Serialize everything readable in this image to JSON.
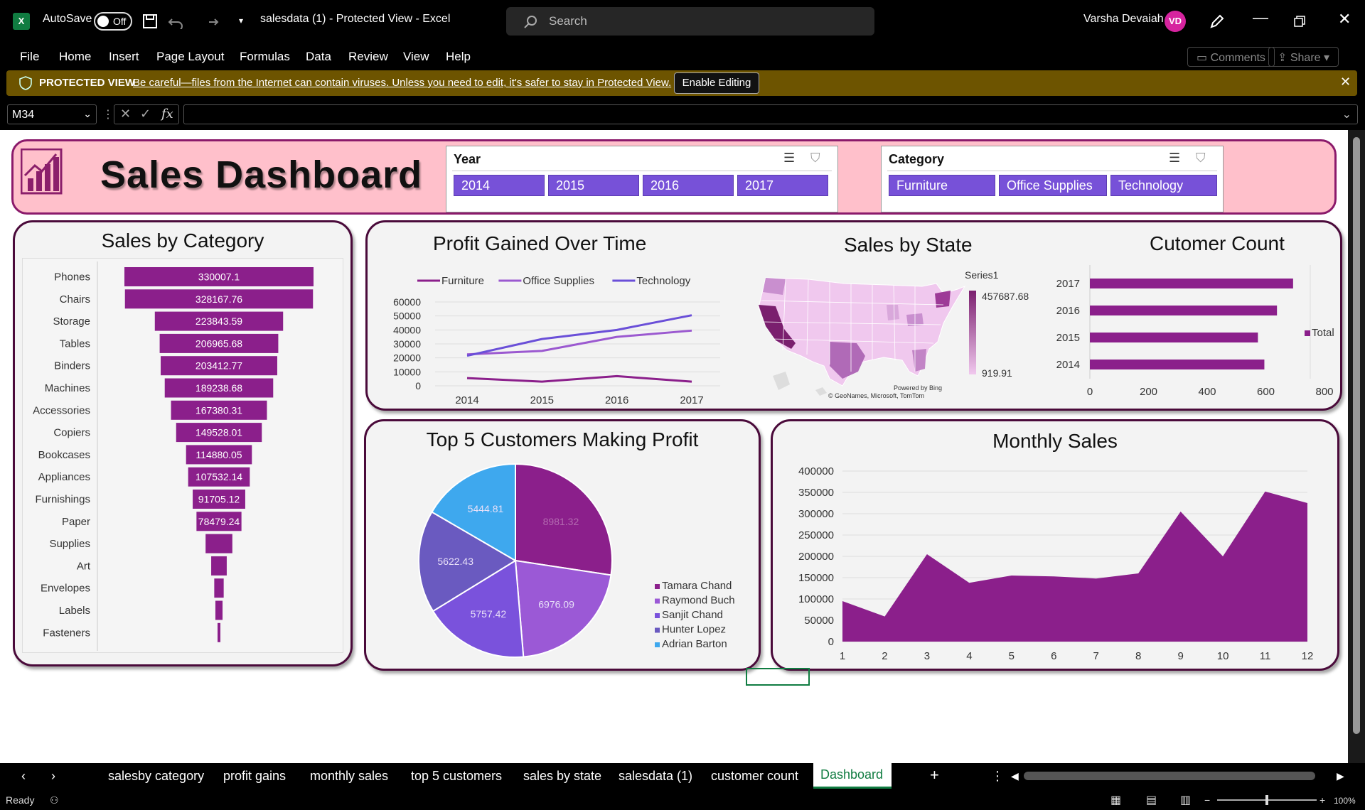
{
  "titlebar": {
    "autosave_label": "AutoSave",
    "autosave_state": "Off",
    "doc_title": "salesdata (1)  -  Protected View  -  Excel",
    "search_placeholder": "Search",
    "user_name": "Varsha Devaiah",
    "user_initials": "VD"
  },
  "menu": [
    "File",
    "Home",
    "Insert",
    "Page Layout",
    "Formulas",
    "Data",
    "Review",
    "View",
    "Help"
  ],
  "ribbon_right": {
    "comments": "Comments",
    "share": "Share"
  },
  "protected_view": {
    "label": "PROTECTED VIEW",
    "message": "Be careful—files from the Internet can contain viruses. Unless you need to edit, it's safer to stay in Protected View.",
    "button": "Enable Editing"
  },
  "formula_bar": {
    "name_box": "M34",
    "fx": "fx"
  },
  "dashboard": {
    "title": "Sales Dashboard",
    "year_slicer": {
      "title": "Year",
      "items": [
        "2014",
        "2015",
        "2016",
        "2017"
      ]
    },
    "category_slicer": {
      "title": "Category",
      "items": [
        "Furniture",
        "Office Supplies",
        "Technology"
      ]
    }
  },
  "colors": {
    "primary": "#8b1f8b",
    "accent": "#7751d8",
    "header_bg": "#ffc0cb",
    "panel_border": "#4a0a3a"
  },
  "chart_data": [
    {
      "id": "sales-by-category",
      "type": "bar",
      "title": "Sales by Category",
      "categories": [
        "Phones",
        "Chairs",
        "Storage",
        "Tables",
        "Binders",
        "Machines",
        "Accessories",
        "Copiers",
        "Bookcases",
        "Appliances",
        "Furnishings",
        "Paper",
        "Supplies",
        "Art",
        "Envelopes",
        "Labels",
        "Fasteners"
      ],
      "values": [
        330007.1,
        328167.76,
        223843.59,
        206965.68,
        203412.77,
        189238.68,
        167380.31,
        149528.01,
        114880.05,
        107532.14,
        91705.12,
        78479.24,
        46673.54,
        27118.79,
        16476.4,
        12486.31,
        3024.28
      ],
      "value_labels": [
        "330007.1",
        "328167.76",
        "223843.59",
        "206965.68",
        "203412.77",
        "189238.68",
        "167380.31",
        "149528.01",
        "114880.05",
        "107532.14",
        "91705.12",
        "78479.24",
        "",
        "",
        "",
        "",
        ""
      ]
    },
    {
      "id": "profit-over-time",
      "type": "line",
      "title": "Profit Gained Over Time",
      "x": [
        "2014",
        "2015",
        "2016",
        "2017"
      ],
      "ylim": [
        0,
        60000
      ],
      "yticks": [
        0,
        10000,
        20000,
        30000,
        40000,
        50000,
        60000
      ],
      "series": [
        {
          "name": "Furniture",
          "color": "#8b1f8b",
          "values": [
            5500,
            3000,
            6900,
            3000
          ]
        },
        {
          "name": "Office Supplies",
          "color": "#9b59d0",
          "values": [
            22500,
            25000,
            35000,
            39500
          ]
        },
        {
          "name": "Technology",
          "color": "#6a4fd8",
          "values": [
            21500,
            33500,
            40000,
            50500
          ]
        }
      ]
    },
    {
      "id": "sales-by-state",
      "type": "heatmap",
      "title": "Sales by State",
      "legend_title": "Series1",
      "max": 457687.68,
      "min": 919.91,
      "max_label": "457687.68",
      "min_label": "919.91",
      "credit1": "Powered by Bing",
      "credit2": "© GeoNames, Microsoft, TomTom"
    },
    {
      "id": "customer-count",
      "type": "bar",
      "title": "Cutomer Count",
      "categories": [
        "2017",
        "2016",
        "2015",
        "2014"
      ],
      "values": [
        693,
        638,
        573,
        595
      ],
      "xlim": [
        0,
        800
      ],
      "xticks": [
        0,
        200,
        400,
        600,
        800
      ],
      "legend": "Total"
    },
    {
      "id": "top5-customers",
      "type": "pie",
      "title": "Top 5 Customers Making Profit",
      "labels": [
        "Tamara Chand",
        "Raymond Buch",
        "Sanjit Chand",
        "Hunter Lopez",
        "Adrian Barton"
      ],
      "values": [
        8981.32,
        6976.09,
        5757.42,
        5622.43,
        5444.81
      ],
      "value_labels": [
        "8981.32",
        "6976.09",
        "5757.42",
        "5622.43",
        "5444.81"
      ],
      "colors": [
        "#8b1f8b",
        "#9b59d6",
        "#7a52dc",
        "#6a5ac0",
        "#3ea8ee"
      ]
    },
    {
      "id": "monthly-sales",
      "type": "area",
      "title": "Monthly Sales",
      "x": [
        "1",
        "2",
        "3",
        "4",
        "5",
        "6",
        "7",
        "8",
        "9",
        "10",
        "11",
        "12"
      ],
      "values": [
        95000,
        59000,
        205000,
        138000,
        155000,
        153000,
        148000,
        160000,
        305000,
        200000,
        352000,
        325000
      ],
      "ylim": [
        0,
        400000
      ],
      "yticks": [
        0,
        50000,
        100000,
        150000,
        200000,
        250000,
        300000,
        350000,
        400000
      ]
    }
  ],
  "sheet_tabs": [
    "salesby category",
    "profit gains",
    "monthly sales",
    "top 5 customers",
    "sales by state",
    "salesdata (1)",
    "customer count",
    "Dashboard"
  ],
  "status": {
    "ready": "Ready",
    "zoom": "100%"
  }
}
